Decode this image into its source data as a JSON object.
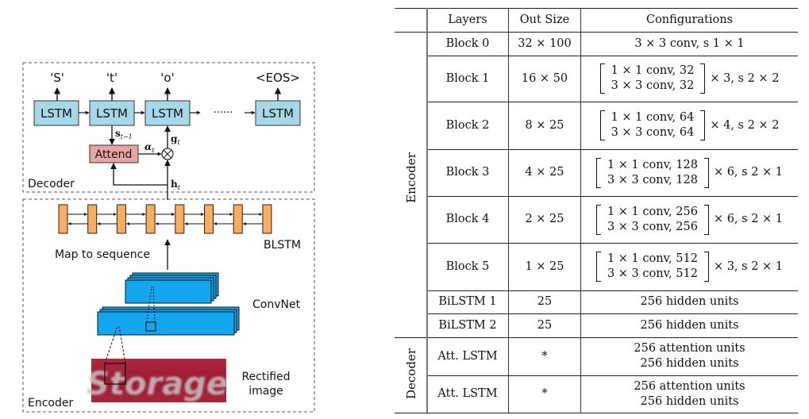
{
  "figure": {
    "diagram": {
      "decoder_label": "Decoder",
      "encoder_label": "Encoder",
      "decoder_outputs": [
        "'S'",
        "'t'",
        "'o'",
        "<EOS>"
      ],
      "lstm_label": "LSTM",
      "ellipsis": "······",
      "attend_label": "Attend",
      "state_label": "s",
      "state_sub": "t−1",
      "alpha_label": "α",
      "alpha_sub": "t",
      "glimpse_label": "g",
      "glimpse_sub": "t",
      "hidden_label": "h",
      "hidden_sub": "t",
      "blstm_label": "BLSTM",
      "map_to_sequence_label": "Map to sequence",
      "convnet_label": "ConvNet",
      "rectified_image_label_line1": "Rectified",
      "rectified_image_label_line2": "image",
      "input_word": "Storage",
      "blstm_cell_count": 8,
      "colors": {
        "lstm_fill": "#a6d8e8",
        "attend_fill": "#e8a5a5",
        "blstm_fill": "#fbac5e",
        "convnet_fill": "#14a7f0",
        "image_bg": "#a01f35"
      }
    },
    "table": {
      "headers": [
        "Layers",
        "Out Size",
        "Configurations"
      ],
      "groups": [
        {
          "label": "Encoder"
        },
        {
          "label": "Decoder"
        }
      ],
      "rows": [
        {
          "layer": "Block 0",
          "out_size": "32 × 100",
          "config": "3 × 3 conv, s 1 × 1"
        },
        {
          "layer": "Block 1",
          "out_size": "16 × 50",
          "config_line1": "1 × 1 conv,  32",
          "config_line2": "3 × 3 conv,  32",
          "config_suffix": "× 3, s 2 × 2"
        },
        {
          "layer": "Block 2",
          "out_size": "8 × 25",
          "config_line1": "1 × 1 conv,  64",
          "config_line2": "3 × 3 conv,  64",
          "config_suffix": "× 4, s 2 × 2"
        },
        {
          "layer": "Block 3",
          "out_size": "4 × 25",
          "config_line1": "1 × 1 conv,  128",
          "config_line2": "3 × 3 conv,  128",
          "config_suffix": "× 6, s 2 × 1"
        },
        {
          "layer": "Block 4",
          "out_size": "2 × 25",
          "config_line1": "1 × 1 conv,  256",
          "config_line2": "3 × 3 conv,  256",
          "config_suffix": "× 6, s 2 × 1"
        },
        {
          "layer": "Block 5",
          "out_size": "1 × 25",
          "config_line1": "1 × 1 conv,  512",
          "config_line2": "3 × 3 conv,  512",
          "config_suffix": "× 3, s 2 × 1"
        },
        {
          "layer": "BiLSTM 1",
          "out_size": "25",
          "config": "256 hidden units"
        },
        {
          "layer": "BiLSTM 2",
          "out_size": "25",
          "config": "256 hidden units"
        },
        {
          "layer": "Att. LSTM",
          "out_size": "*",
          "config_line1": "256 attention units",
          "config_line2": "256 hidden units"
        },
        {
          "layer": "Att. LSTM",
          "out_size": "*",
          "config_line1": "256 attention units",
          "config_line2": "256 hidden units"
        }
      ]
    }
  }
}
